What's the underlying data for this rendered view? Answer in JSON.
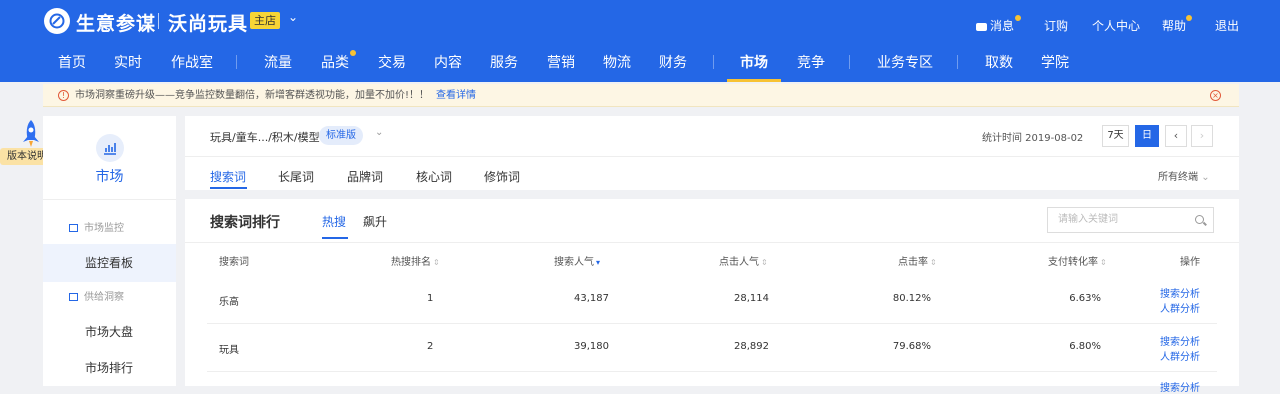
{
  "header": {
    "brand": "生意参谋",
    "shop_name": "沃尚玩具",
    "shop_badge": "主店",
    "links": [
      "消息",
      "订购",
      "个人中心",
      "帮助",
      "退出"
    ]
  },
  "nav": {
    "items": [
      "首页",
      "实时",
      "作战室",
      "流量",
      "品类",
      "交易",
      "内容",
      "服务",
      "营销",
      "物流",
      "财务",
      "市场",
      "竞争",
      "业务专区",
      "取数",
      "学院"
    ],
    "active": "市场"
  },
  "notice": {
    "text": "市场洞察重磅升级——竞争监控数量翻倍，新增客群透视功能，加量不加价!！！",
    "link": "查看详情"
  },
  "version_badge": "版本说明",
  "sidebar": {
    "title": "市场",
    "groups": [
      {
        "label": "市场监控",
        "items": [
          "监控看板"
        ]
      },
      {
        "label": "供给洞察",
        "items": [
          "市场大盘",
          "市场排行"
        ]
      }
    ],
    "active_item": "监控看板"
  },
  "filter": {
    "breadcrumb": "玩具/童车.../积木/模型",
    "edition": "标准版",
    "stat_time": "统计时间 2019-08-02",
    "range_7d": "7天",
    "range_day": "日",
    "prev": "‹",
    "next": "›",
    "tabs": [
      "搜索词",
      "长尾词",
      "品牌词",
      "核心词",
      "修饰词"
    ],
    "active_tab": "搜索词",
    "terminal": "所有终端"
  },
  "ranking": {
    "title": "搜索词排行",
    "sub_tabs": [
      "热搜",
      "飙升"
    ],
    "active_sub_tab": "热搜",
    "search_placeholder": "请输入关键词",
    "columns": [
      "搜索词",
      "热搜排名",
      "搜索人气",
      "点击人气",
      "点击率",
      "支付转化率",
      "操作"
    ],
    "rows": [
      {
        "keyword": "乐高",
        "rank": "1",
        "search_popularity": "43,187",
        "click_popularity": "28,114",
        "ctr": "80.12%",
        "conversion": "6.63%",
        "actions": [
          "搜索分析",
          "人群分析"
        ]
      },
      {
        "keyword": "玩具",
        "rank": "2",
        "search_popularity": "39,180",
        "click_popularity": "28,892",
        "ctr": "79.68%",
        "conversion": "6.80%",
        "actions": [
          "搜索分析",
          "人群分析"
        ]
      }
    ],
    "partial_row_action": "搜索分析"
  },
  "colors": {
    "primary": "#2467e6",
    "accent": "#f7c234",
    "notice_bg": "#fdf6e4"
  }
}
